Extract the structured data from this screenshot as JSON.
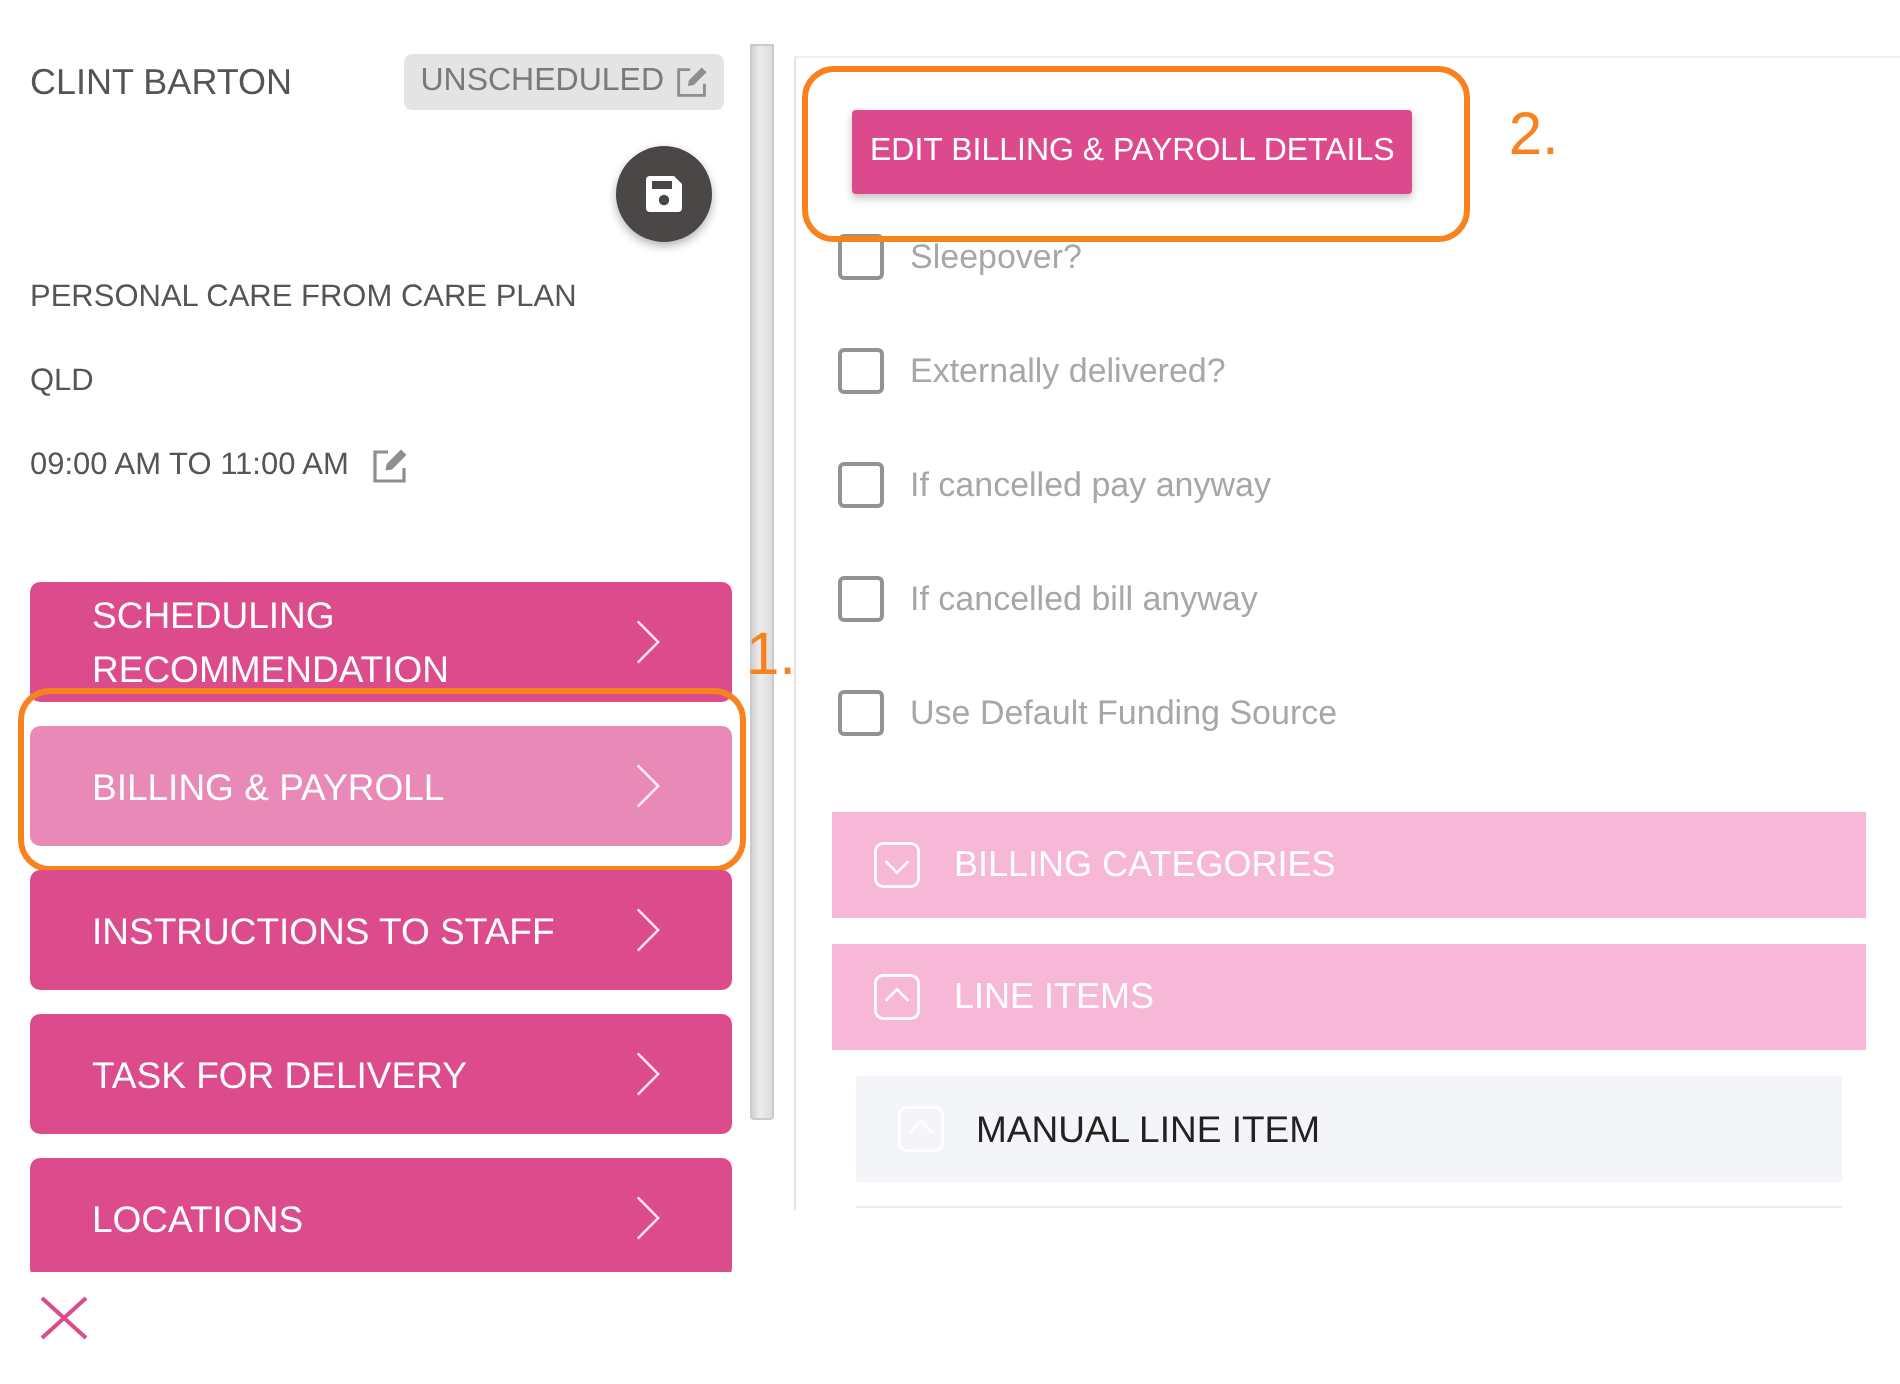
{
  "header": {
    "name": "CLINT BARTON",
    "status_badge": "UNSCHEDULED"
  },
  "details": [
    "PERSONAL CARE FROM CARE PLAN",
    "QLD"
  ],
  "time": "09:00 AM TO 11:00 AM",
  "nav": [
    {
      "label": "SCHEDULING RECOMMENDATION",
      "selected": false
    },
    {
      "label": "BILLING & PAYROLL",
      "selected": true,
      "annotation": "1."
    },
    {
      "label": "INSTRUCTIONS TO STAFF",
      "selected": false
    },
    {
      "label": "TASK FOR DELIVERY",
      "selected": false
    },
    {
      "label": "LOCATIONS",
      "selected": false
    }
  ],
  "edit_button": {
    "label": "EDIT BILLING & PAYROLL DETAILS",
    "annotation": "2."
  },
  "options": [
    {
      "label": "Sleepover?",
      "checked": false,
      "disabled": true
    },
    {
      "label": "Externally delivered?",
      "checked": false,
      "disabled": true
    },
    {
      "label": "If cancelled pay anyway",
      "checked": false,
      "disabled": true
    },
    {
      "label": "If cancelled bill anyway",
      "checked": false,
      "disabled": true
    },
    {
      "label": "Use Default Funding Source",
      "checked": false,
      "disabled": true
    }
  ],
  "sections": [
    {
      "title": "BILLING CATEGORIES",
      "expanded": false
    },
    {
      "title": "LINE ITEMS",
      "expanded": true,
      "children": [
        {
          "title": "MANUAL LINE ITEM",
          "expanded": true
        }
      ]
    }
  ]
}
